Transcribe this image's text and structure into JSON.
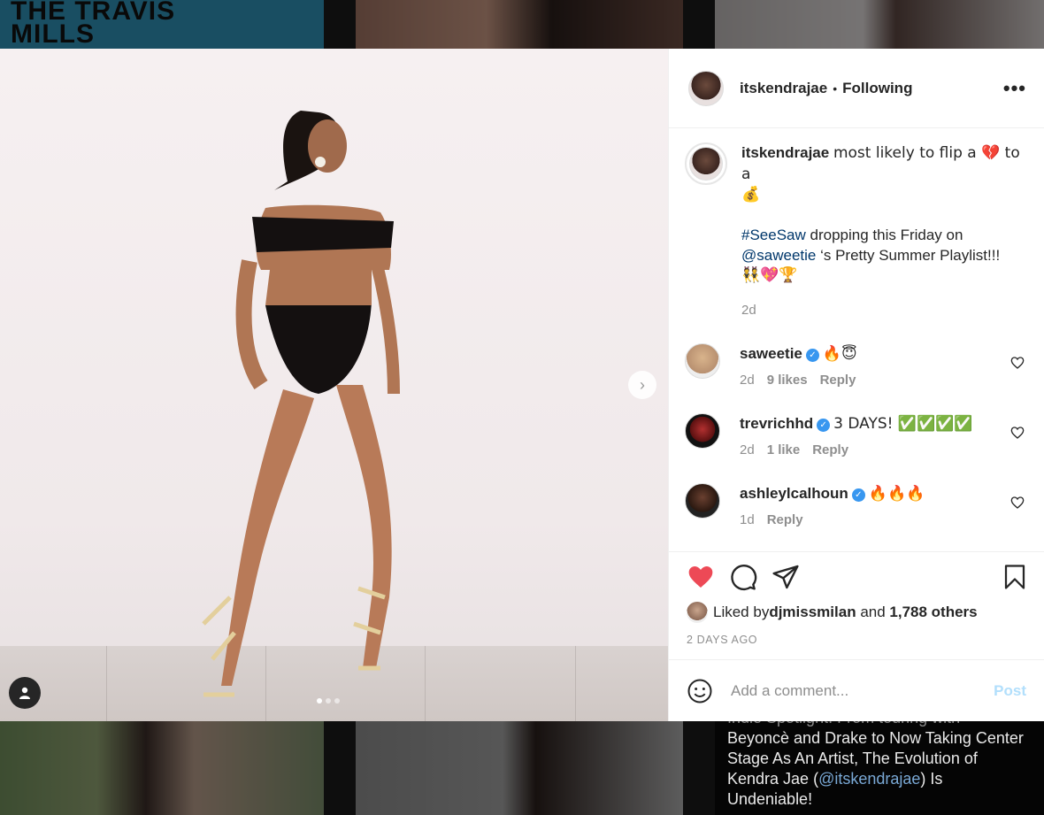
{
  "background": {
    "top_left_text": "THE TRAVIS MILLS",
    "article_text_lines": [
      "Indie Spotlight: From touring with",
      "Beyoncè and Drake to Now Taking Center",
      "Stage As An Artist, The Evolution of"
    ],
    "article_line_4_prefix": "Kendra Jae (",
    "article_mention": "@itskendrajae",
    "article_line_4_suffix": ") Is",
    "article_line_5": "Undeniable!"
  },
  "post": {
    "username": "itskendrajae",
    "dot": "•",
    "follow_status": "Following",
    "more": "•••",
    "caption_line1": "most likely to flip a 💔 to a",
    "caption_line2": "💰",
    "caption_hashtag": "#SeeSaw",
    "caption_text2": " dropping this Friday on",
    "caption_mention": "@saweetie",
    "caption_text3": " ‘s Pretty Summer Playlist!!!",
    "caption_emojis": "👯💖🏆",
    "caption_time": "2d",
    "comments": [
      {
        "user": "saweetie",
        "text": "🔥😇",
        "time": "2d",
        "likes": "9 likes",
        "reply": "Reply"
      },
      {
        "user": "trevrichhd",
        "text": "3 DAYS! ✅✅✅✅",
        "time": "2d",
        "likes": "1 like",
        "reply": "Reply"
      },
      {
        "user": "ashleylcalhoun",
        "text": "🔥🔥🔥",
        "time": "1d",
        "likes": "",
        "reply": "Reply"
      }
    ],
    "liked_by_prefix": "Liked by ",
    "liked_by_user": "djmissmilan",
    "liked_by_mid": " and ",
    "liked_by_count": "1,788 others",
    "posted_ago": "2 DAYS AGO",
    "comment_placeholder": "Add a comment...",
    "post_button": "Post",
    "carousel": {
      "count": 3,
      "active": 1
    }
  },
  "colors": {
    "like_red": "#ed4956",
    "link": "#00376b",
    "verified": "#3897f0",
    "post_disabled": "#b2dffc"
  },
  "icons": [
    "heart-icon",
    "comment-icon",
    "share-icon",
    "bookmark-icon",
    "emoji-icon",
    "verified-icon",
    "user-tag-icon",
    "chevron-right-icon"
  ]
}
